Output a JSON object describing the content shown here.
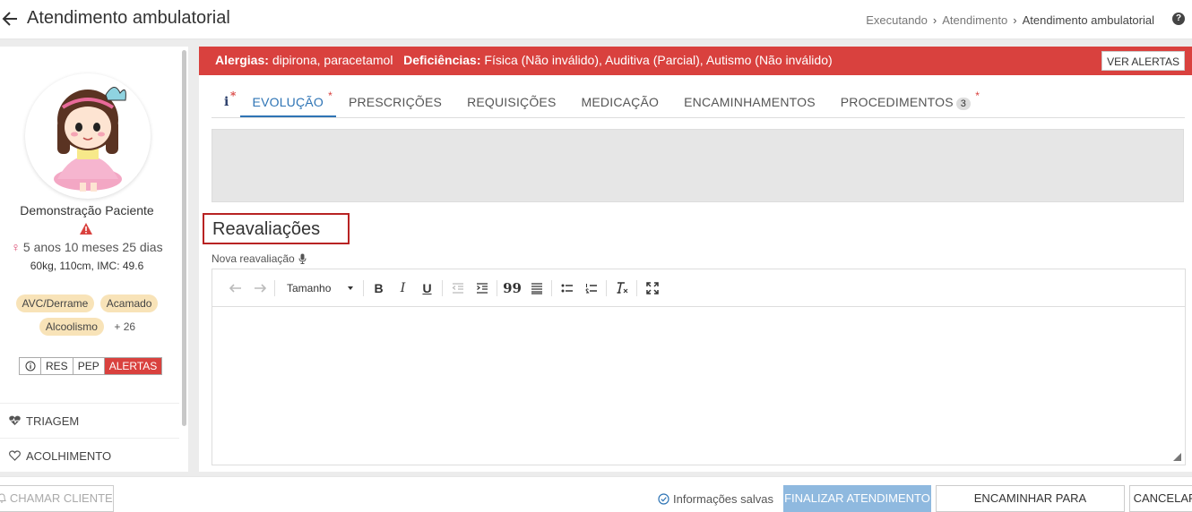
{
  "header": {
    "title": "Atendimento ambulatorial",
    "breadcrumb": [
      "Executando",
      "Atendimento",
      "Atendimento ambulatorial"
    ],
    "help_label": "?"
  },
  "patient": {
    "name": "Demonstração Paciente",
    "age": "5 anos 10 meses 25 dias",
    "measures": "60kg, 110cm, IMC: 49.6",
    "tags": [
      "AVC/Derrame",
      "Acamado",
      "Alcoolismo"
    ],
    "tags_more": "+ 26",
    "buttons": [
      "RES",
      "PEP",
      "ALERTAS"
    ]
  },
  "side_menu": [
    {
      "label": "TRIAGEM",
      "icon": "heartbeat-icon"
    },
    {
      "label": "ACOLHIMENTO",
      "icon": "heart-outline-icon"
    }
  ],
  "alert_bar": {
    "alergias_label": "Alergias:",
    "alergias_value": "dipirona, paracetamol",
    "deficiencias_label": "Deficiências:",
    "deficiencias_value": "Física (Não inválido), Auditiva (Parcial), Autismo (Não inválido)",
    "button": "VER ALERTAS",
    "color": "#d9413e"
  },
  "tabs": [
    {
      "label": "EVOLUÇÃO",
      "active": true,
      "required": true
    },
    {
      "label": "PRESCRIÇÕES"
    },
    {
      "label": "REQUISIÇÕES"
    },
    {
      "label": "MEDICAÇÃO"
    },
    {
      "label": "ENCAMINHAMENTOS"
    },
    {
      "label": "PROCEDIMENTOS",
      "count": "3",
      "required": true
    }
  ],
  "info_tab_label": "i",
  "required_mark": "*",
  "section": {
    "title": "Reavaliações",
    "editor_label": "Nova reavaliação"
  },
  "editor": {
    "size_select": "Tamanho",
    "bold": "B",
    "italic": "I",
    "underline": "U",
    "quote": "99"
  },
  "footer": {
    "chamar": "CHAMAR CLIENTE",
    "saved": "Informações salvas",
    "finalizar": "FINALIZAR ATENDIMENTO",
    "encaminhar": "ENCAMINHAR PARA OBSERVAÇÃO",
    "cancelar": "CANCELAR"
  },
  "colors": {
    "accent": "#2e74b5",
    "danger": "#d9413e",
    "tag_bg": "#f8e3b8",
    "primary_disabled": "#8fb9df"
  }
}
